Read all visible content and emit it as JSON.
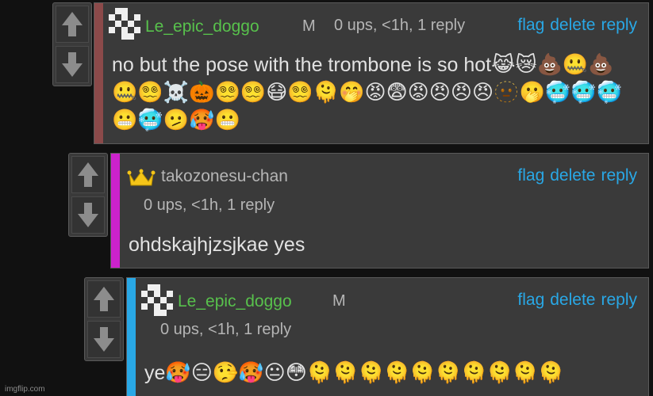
{
  "comments": [
    {
      "username": "Le_epic_doggo",
      "mod_badge": "M",
      "meta": "0 ups, <1h, 1 reply",
      "actions": [
        "flag",
        "delete",
        "reply"
      ],
      "body": "no but the pose with the trombone is so hot",
      "emoji": "😹😿💩🤐💩🤐😵‍💫☠️🎃😵‍💫😵‍💫😷😵‍💫🫠🤭😡😨😡😠😠😠🫥🫢🥶🥶🥶😬🥶🫤🥵😬",
      "stripe_color": "#8b4a4a"
    },
    {
      "username": "takozonesu-chan",
      "meta": "0 ups, <1h, 1 reply",
      "actions": [
        "flag",
        "delete",
        "reply"
      ],
      "body": "ohdskajhjzsjkae yes",
      "stripe_color": "#cc22cc"
    },
    {
      "username": "Le_epic_doggo",
      "mod_badge": "M",
      "meta": "0 ups, <1h, 1 reply",
      "actions": [
        "flag",
        "delete",
        "reply"
      ],
      "body": "ye",
      "emoji": "🥵😑🤥🥵😐😳🫠🫠🫠🫠🫠🫠🫠🫠🫠🫠",
      "stripe_color": "#29a8e6"
    }
  ],
  "watermark": "imgflip.com"
}
